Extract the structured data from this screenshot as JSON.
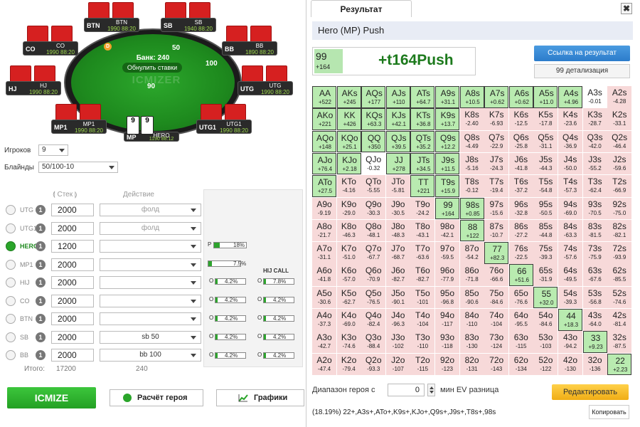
{
  "table": {
    "bank": "Банк: 240",
    "refresh": "Обнулить ставки",
    "logo": "ICMIZER",
    "chips": {
      "sb": "50",
      "bb": "100",
      "hero": "90"
    },
    "dealer": "D",
    "hero_cards": [
      "9",
      "9"
    ],
    "seats": [
      {
        "pos": "BTN",
        "name": "BTN",
        "stack": "1990 88:20"
      },
      {
        "pos": "SB",
        "name": "SB",
        "stack": "1940 88:20"
      },
      {
        "pos": "CO",
        "name": "CO",
        "stack": "1990 88:20"
      },
      {
        "pos": "BB",
        "name": "BB",
        "stack": "1890 88:20"
      },
      {
        "pos": "HJ",
        "name": "HJ",
        "stack": "1990 88:20"
      },
      {
        "pos": "UTG",
        "name": "UTG",
        "stack": "1990 88:20"
      },
      {
        "pos": "MP1",
        "name": "MP1",
        "stack": "1990 88:20"
      },
      {
        "pos": "MP",
        "name": "HERO",
        "stack": "1190 88:12"
      },
      {
        "pos": "UTG1",
        "name": "UTG1",
        "stack": "1990 88:20"
      }
    ]
  },
  "settings": {
    "players_label": "Игроков",
    "players_value": "9",
    "blinds_label": "Блайнды",
    "blinds_value": "50/100-10"
  },
  "players_table": {
    "col_stack": "Стек",
    "col_action": "Действие",
    "rows": [
      {
        "name": "UTG",
        "num": "1",
        "stack": "2000",
        "action": "фолд"
      },
      {
        "name": "UTG1",
        "num": "1",
        "stack": "2000",
        "action": "фолд"
      },
      {
        "name": "HERO",
        "num": "1",
        "stack": "1200",
        "action": ""
      },
      {
        "name": "MP1",
        "num": "1",
        "stack": "2000",
        "action": ""
      },
      {
        "name": "HIJ",
        "num": "1",
        "stack": "2000",
        "action": ""
      },
      {
        "name": "CO",
        "num": "1",
        "stack": "2000",
        "action": ""
      },
      {
        "name": "BTN",
        "num": "1",
        "stack": "2000",
        "action": ""
      },
      {
        "name": "SB",
        "num": "1",
        "stack": "2000",
        "action": "sb 50"
      },
      {
        "name": "BB",
        "num": "1",
        "stack": "2000",
        "action": "bb 100"
      }
    ],
    "total_label": "Итого:",
    "total_stack": "17200",
    "total_action": "240"
  },
  "ranges": {
    "p_label": "P",
    "p_value": "18%",
    "hero_value": "7.5%",
    "col2_title": "HIJ CALL",
    "col2_first": "7.8%",
    "value": "4.2%",
    "o_label": "O"
  },
  "buttons": {
    "icmize": "ICMIZE",
    "hero_calc": "Расчёт героя",
    "charts": "Графики"
  },
  "result": {
    "tab": "Результат",
    "close": "✖",
    "title": "Hero (MP) Push",
    "hand": "99",
    "hand_ev": "+164",
    "big": "+t164Push",
    "link_btn": "Ссылка на результат",
    "detail_btn": "99 детализация",
    "range_label": "Диапазон героя с",
    "range_input": "0",
    "range_min": "мин EV разница",
    "edit_btn": "Редактировать",
    "range_text": "(18.19%) 22+,A3s+,ATo+,K9s+,KJo+,Q9s+,J9s+,T8s+,98s",
    "copy_btn": "Копировать"
  },
  "grid": [
    [
      [
        "AA",
        "+522",
        "p"
      ],
      [
        "AKs",
        "+245",
        "p"
      ],
      [
        "AQs",
        "+177",
        "p"
      ],
      [
        "AJs",
        "+110",
        "p"
      ],
      [
        "ATs",
        "+64.7",
        "p"
      ],
      [
        "A9s",
        "+31.1",
        "p"
      ],
      [
        "A8s",
        "+10.5",
        "p"
      ],
      [
        "A7s",
        "+0.62",
        "p"
      ],
      [
        "A6s",
        "+0.62",
        "p"
      ],
      [
        "A5s",
        "+11.0",
        "p"
      ],
      [
        "A4s",
        "+4.96",
        "p"
      ],
      [
        "A3s",
        "-0.01",
        "n"
      ],
      [
        "A2s",
        "-4.28",
        "f"
      ]
    ],
    [
      [
        "AKo",
        "+221",
        "p"
      ],
      [
        "KK",
        "+426",
        "p"
      ],
      [
        "KQs",
        "+63.3",
        "p"
      ],
      [
        "KJs",
        "+42.1",
        "p"
      ],
      [
        "KTs",
        "+36.8",
        "p"
      ],
      [
        "K9s",
        "+13.7",
        "p"
      ],
      [
        "K8s",
        "-2.40",
        "f"
      ],
      [
        "K7s",
        "-6.93",
        "f"
      ],
      [
        "K6s",
        "-12.5",
        "f"
      ],
      [
        "K5s",
        "-17.8",
        "f"
      ],
      [
        "K4s",
        "-23.6",
        "f"
      ],
      [
        "K3s",
        "-28.7",
        "f"
      ],
      [
        "K2s",
        "-33.1",
        "f"
      ]
    ],
    [
      [
        "AQo",
        "+148",
        "p"
      ],
      [
        "KQo",
        "+25.1",
        "p"
      ],
      [
        "QQ",
        "+350",
        "p"
      ],
      [
        "QJs",
        "+39.5",
        "p"
      ],
      [
        "QTs",
        "+35.2",
        "p"
      ],
      [
        "Q9s",
        "+12.2",
        "p"
      ],
      [
        "Q8s",
        "-4.49",
        "f"
      ],
      [
        "Q7s",
        "-22.9",
        "f"
      ],
      [
        "Q6s",
        "-25.8",
        "f"
      ],
      [
        "Q5s",
        "-31.1",
        "f"
      ],
      [
        "Q4s",
        "-36.9",
        "f"
      ],
      [
        "Q3s",
        "-42.0",
        "f"
      ],
      [
        "Q2s",
        "-46.4",
        "f"
      ]
    ],
    [
      [
        "AJo",
        "+76.4",
        "p"
      ],
      [
        "KJo",
        "+2.18",
        "p"
      ],
      [
        "QJo",
        "-0.32",
        "n"
      ],
      [
        "JJ",
        "+278",
        "p"
      ],
      [
        "JTs",
        "+34.5",
        "p"
      ],
      [
        "J9s",
        "+11.5",
        "p"
      ],
      [
        "J8s",
        "-5.16",
        "f"
      ],
      [
        "J7s",
        "-24.3",
        "f"
      ],
      [
        "J6s",
        "-41.8",
        "f"
      ],
      [
        "J5s",
        "-44.3",
        "f"
      ],
      [
        "J4s",
        "-50.0",
        "f"
      ],
      [
        "J3s",
        "-55.2",
        "f"
      ],
      [
        "J2s",
        "-59.6",
        "f"
      ]
    ],
    [
      [
        "ATo",
        "+27.5",
        "p"
      ],
      [
        "KTo",
        "-4.16",
        "f"
      ],
      [
        "QTo",
        "-5.55",
        "f"
      ],
      [
        "JTo",
        "-5.81",
        "f"
      ],
      [
        "TT",
        "+221",
        "p"
      ],
      [
        "T9s",
        "+15.9",
        "p"
      ],
      [
        "T8s",
        "-0.12",
        "f"
      ],
      [
        "T7s",
        "-19.4",
        "f"
      ],
      [
        "T6s",
        "-37.2",
        "f"
      ],
      [
        "T5s",
        "-54.8",
        "f"
      ],
      [
        "T4s",
        "-57.3",
        "f"
      ],
      [
        "T3s",
        "-62.4",
        "f"
      ],
      [
        "T2s",
        "-66.9",
        "f"
      ]
    ],
    [
      [
        "A9o",
        "-9.19",
        "f"
      ],
      [
        "K9o",
        "-29.0",
        "f"
      ],
      [
        "Q9o",
        "-30.3",
        "f"
      ],
      [
        "J9o",
        "-30.5",
        "f"
      ],
      [
        "T9o",
        "-24.2",
        "f"
      ],
      [
        "99",
        "+164",
        "p"
      ],
      [
        "98s",
        "+0.85",
        "p"
      ],
      [
        "97s",
        "-15.6",
        "f"
      ],
      [
        "96s",
        "-32.8",
        "f"
      ],
      [
        "95s",
        "-50.5",
        "f"
      ],
      [
        "94s",
        "-69.0",
        "f"
      ],
      [
        "93s",
        "-70.5",
        "f"
      ],
      [
        "92s",
        "-75.0",
        "f"
      ]
    ],
    [
      [
        "A8o",
        "-21.7",
        "f"
      ],
      [
        "K8o",
        "-46.3",
        "f"
      ],
      [
        "Q8o",
        "-48.1",
        "f"
      ],
      [
        "J8o",
        "-48.3",
        "f"
      ],
      [
        "T8o",
        "-43.1",
        "f"
      ],
      [
        "98o",
        "-42.1",
        "f"
      ],
      [
        "88",
        "+122",
        "p"
      ],
      [
        "87s",
        "-10.7",
        "f"
      ],
      [
        "86s",
        "-27.2",
        "f"
      ],
      [
        "85s",
        "-44.8",
        "f"
      ],
      [
        "84s",
        "-63.3",
        "f"
      ],
      [
        "83s",
        "-81.5",
        "f"
      ],
      [
        "82s",
        "-82.1",
        "f"
      ]
    ],
    [
      [
        "A7o",
        "-31.1",
        "f"
      ],
      [
        "K7o",
        "-51.0",
        "f"
      ],
      [
        "Q7o",
        "-67.7",
        "f"
      ],
      [
        "J7o",
        "-68.7",
        "f"
      ],
      [
        "T7o",
        "-63.6",
        "f"
      ],
      [
        "97o",
        "-59.5",
        "f"
      ],
      [
        "87o",
        "-54.2",
        "f"
      ],
      [
        "77",
        "+82.3",
        "p"
      ],
      [
        "76s",
        "-22.5",
        "f"
      ],
      [
        "75s",
        "-39.3",
        "f"
      ],
      [
        "74s",
        "-57.6",
        "f"
      ],
      [
        "73s",
        "-75.9",
        "f"
      ],
      [
        "72s",
        "-93.9",
        "f"
      ]
    ],
    [
      [
        "A6o",
        "-41.8",
        "f"
      ],
      [
        "K6o",
        "-57.0",
        "f"
      ],
      [
        "Q6o",
        "-70.9",
        "f"
      ],
      [
        "J6o",
        "-82.7",
        "f"
      ],
      [
        "T6o",
        "-82.7",
        "f"
      ],
      [
        "96o",
        "-77.9",
        "f"
      ],
      [
        "86o",
        "-71.8",
        "f"
      ],
      [
        "76o",
        "-66.6",
        "f"
      ],
      [
        "66",
        "+51.6",
        "p"
      ],
      [
        "65s",
        "-31.9",
        "f"
      ],
      [
        "64s",
        "-49.5",
        "f"
      ],
      [
        "63s",
        "-67.6",
        "f"
      ],
      [
        "62s",
        "-85.5",
        "f"
      ]
    ],
    [
      [
        "A5o",
        "-30.6",
        "f"
      ],
      [
        "K5o",
        "-62.7",
        "f"
      ],
      [
        "Q5o",
        "-76.5",
        "f"
      ],
      [
        "J5o",
        "-90.1",
        "f"
      ],
      [
        "T5o",
        "-101",
        "f"
      ],
      [
        "95o",
        "-96.8",
        "f"
      ],
      [
        "85o",
        "-90.6",
        "f"
      ],
      [
        "75o",
        "-84.6",
        "f"
      ],
      [
        "65o",
        "-76.6",
        "f"
      ],
      [
        "55",
        "+32.0",
        "p"
      ],
      [
        "54s",
        "-39.3",
        "f"
      ],
      [
        "53s",
        "-56.8",
        "f"
      ],
      [
        "52s",
        "-74.6",
        "f"
      ]
    ],
    [
      [
        "A4o",
        "-37.3",
        "f"
      ],
      [
        "K4o",
        "-69.0",
        "f"
      ],
      [
        "Q4o",
        "-82.4",
        "f"
      ],
      [
        "J4o",
        "-96.3",
        "f"
      ],
      [
        "T4o",
        "-104",
        "f"
      ],
      [
        "94o",
        "-117",
        "f"
      ],
      [
        "84o",
        "-110",
        "f"
      ],
      [
        "74o",
        "-104",
        "f"
      ],
      [
        "64o",
        "-95.5",
        "f"
      ],
      [
        "54o",
        "-84.6",
        "f"
      ],
      [
        "44",
        "+18.3",
        "p"
      ],
      [
        "43s",
        "-64.0",
        "f"
      ],
      [
        "42s",
        "-81.4",
        "f"
      ]
    ],
    [
      [
        "A3o",
        "-42.7",
        "f"
      ],
      [
        "K3o",
        "-74.6",
        "f"
      ],
      [
        "Q3o",
        "-88.4",
        "f"
      ],
      [
        "J3o",
        "-102",
        "f"
      ],
      [
        "T3o",
        "-110",
        "f"
      ],
      [
        "93o",
        "-118",
        "f"
      ],
      [
        "83o",
        "-130",
        "f"
      ],
      [
        "73o",
        "-124",
        "f"
      ],
      [
        "63o",
        "-115",
        "f"
      ],
      [
        "53o",
        "-103",
        "f"
      ],
      [
        "43o",
        "-94.2",
        "f"
      ],
      [
        "33",
        "+9.23",
        "p"
      ],
      [
        "32s",
        "-87.5",
        "f"
      ]
    ],
    [
      [
        "A2o",
        "-47.4",
        "f"
      ],
      [
        "K2o",
        "-79.4",
        "f"
      ],
      [
        "Q2o",
        "-93.3",
        "f"
      ],
      [
        "J2o",
        "-107",
        "f"
      ],
      [
        "T2o",
        "-115",
        "f"
      ],
      [
        "92o",
        "-123",
        "f"
      ],
      [
        "82o",
        "-131",
        "f"
      ],
      [
        "72o",
        "-143",
        "f"
      ],
      [
        "62o",
        "-134",
        "f"
      ],
      [
        "52o",
        "-122",
        "f"
      ],
      [
        "42o",
        "-130",
        "f"
      ],
      [
        "32o",
        "-136",
        "f"
      ],
      [
        "22",
        "+2.23",
        "p"
      ]
    ]
  ]
}
